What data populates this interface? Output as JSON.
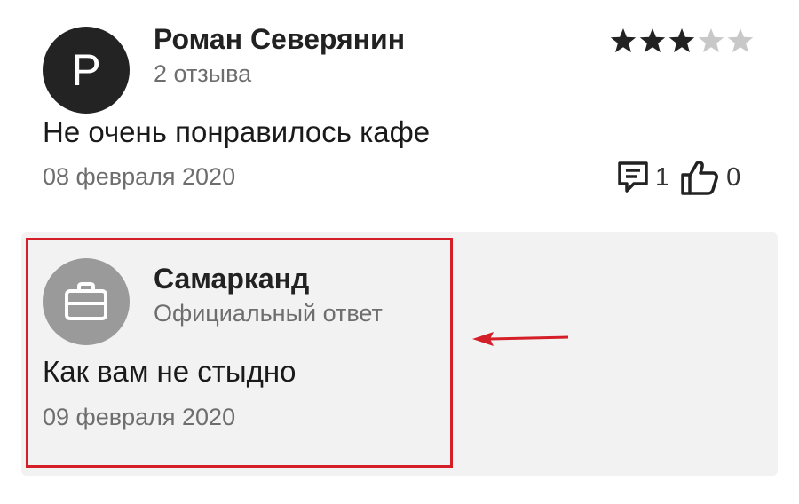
{
  "review": {
    "avatar_letter": "P",
    "author_name": "Роман Северянин",
    "review_count": "2 отзыва",
    "rating": 3,
    "rating_max": 5,
    "text": "Не очень понравилось кафе",
    "date": "08 февраля 2020",
    "comments_count": "1",
    "likes_count": "0"
  },
  "reply": {
    "avatar_icon": "briefcase-icon",
    "org_name": "Самарканд",
    "role": "Официальный ответ",
    "text": "Как вам не стыдно",
    "date": "09 февраля 2020"
  },
  "colors": {
    "avatar_bg": "#232323",
    "org_avatar_bg": "#9a9a9a",
    "star_filled": "#222222",
    "star_empty": "#c8c8c8",
    "reply_bg": "#f2f2f2",
    "highlight": "#d41f28"
  }
}
